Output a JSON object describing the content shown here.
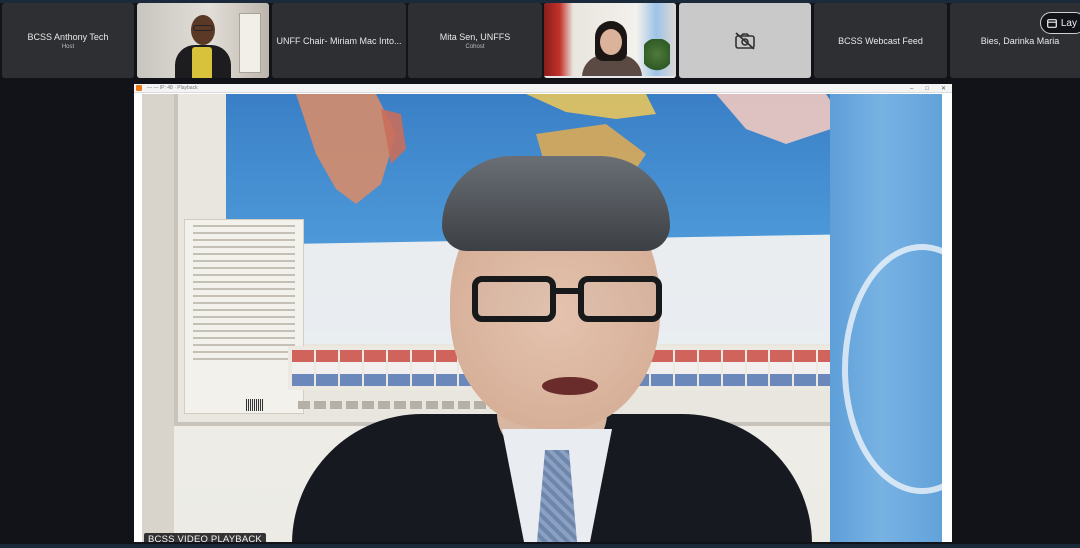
{
  "participants": [
    {
      "name": "BCSS Anthony Tech",
      "role": "Host"
    },
    {
      "name": "",
      "role": "",
      "has_video": true
    },
    {
      "name": "UNFF Chair- Miriam Mac Into...",
      "role": ""
    },
    {
      "name": "Mita Sen, UNFFS",
      "role": "Cohost"
    },
    {
      "name": "",
      "role": "",
      "has_video": true,
      "active_speaker": true
    },
    {
      "name": "",
      "role": "",
      "camera_off": true,
      "icon": "camera-off-icon"
    },
    {
      "name": "BCSS Webcast Feed",
      "role": ""
    },
    {
      "name": "Bies, Darinka Maria",
      "role": ""
    }
  ],
  "layout_button": {
    "label": "Lay",
    "icon": "layout-icon"
  },
  "main_window": {
    "title": "BCSS VIDEO PLAYBACK",
    "window_title_small": "— — IP: 48 · Playback",
    "controls": [
      "–",
      "□",
      "✕"
    ]
  },
  "colors": {
    "background": "#111318",
    "tile": "#2e2f33",
    "accent_bar": "#1b2a3a"
  }
}
